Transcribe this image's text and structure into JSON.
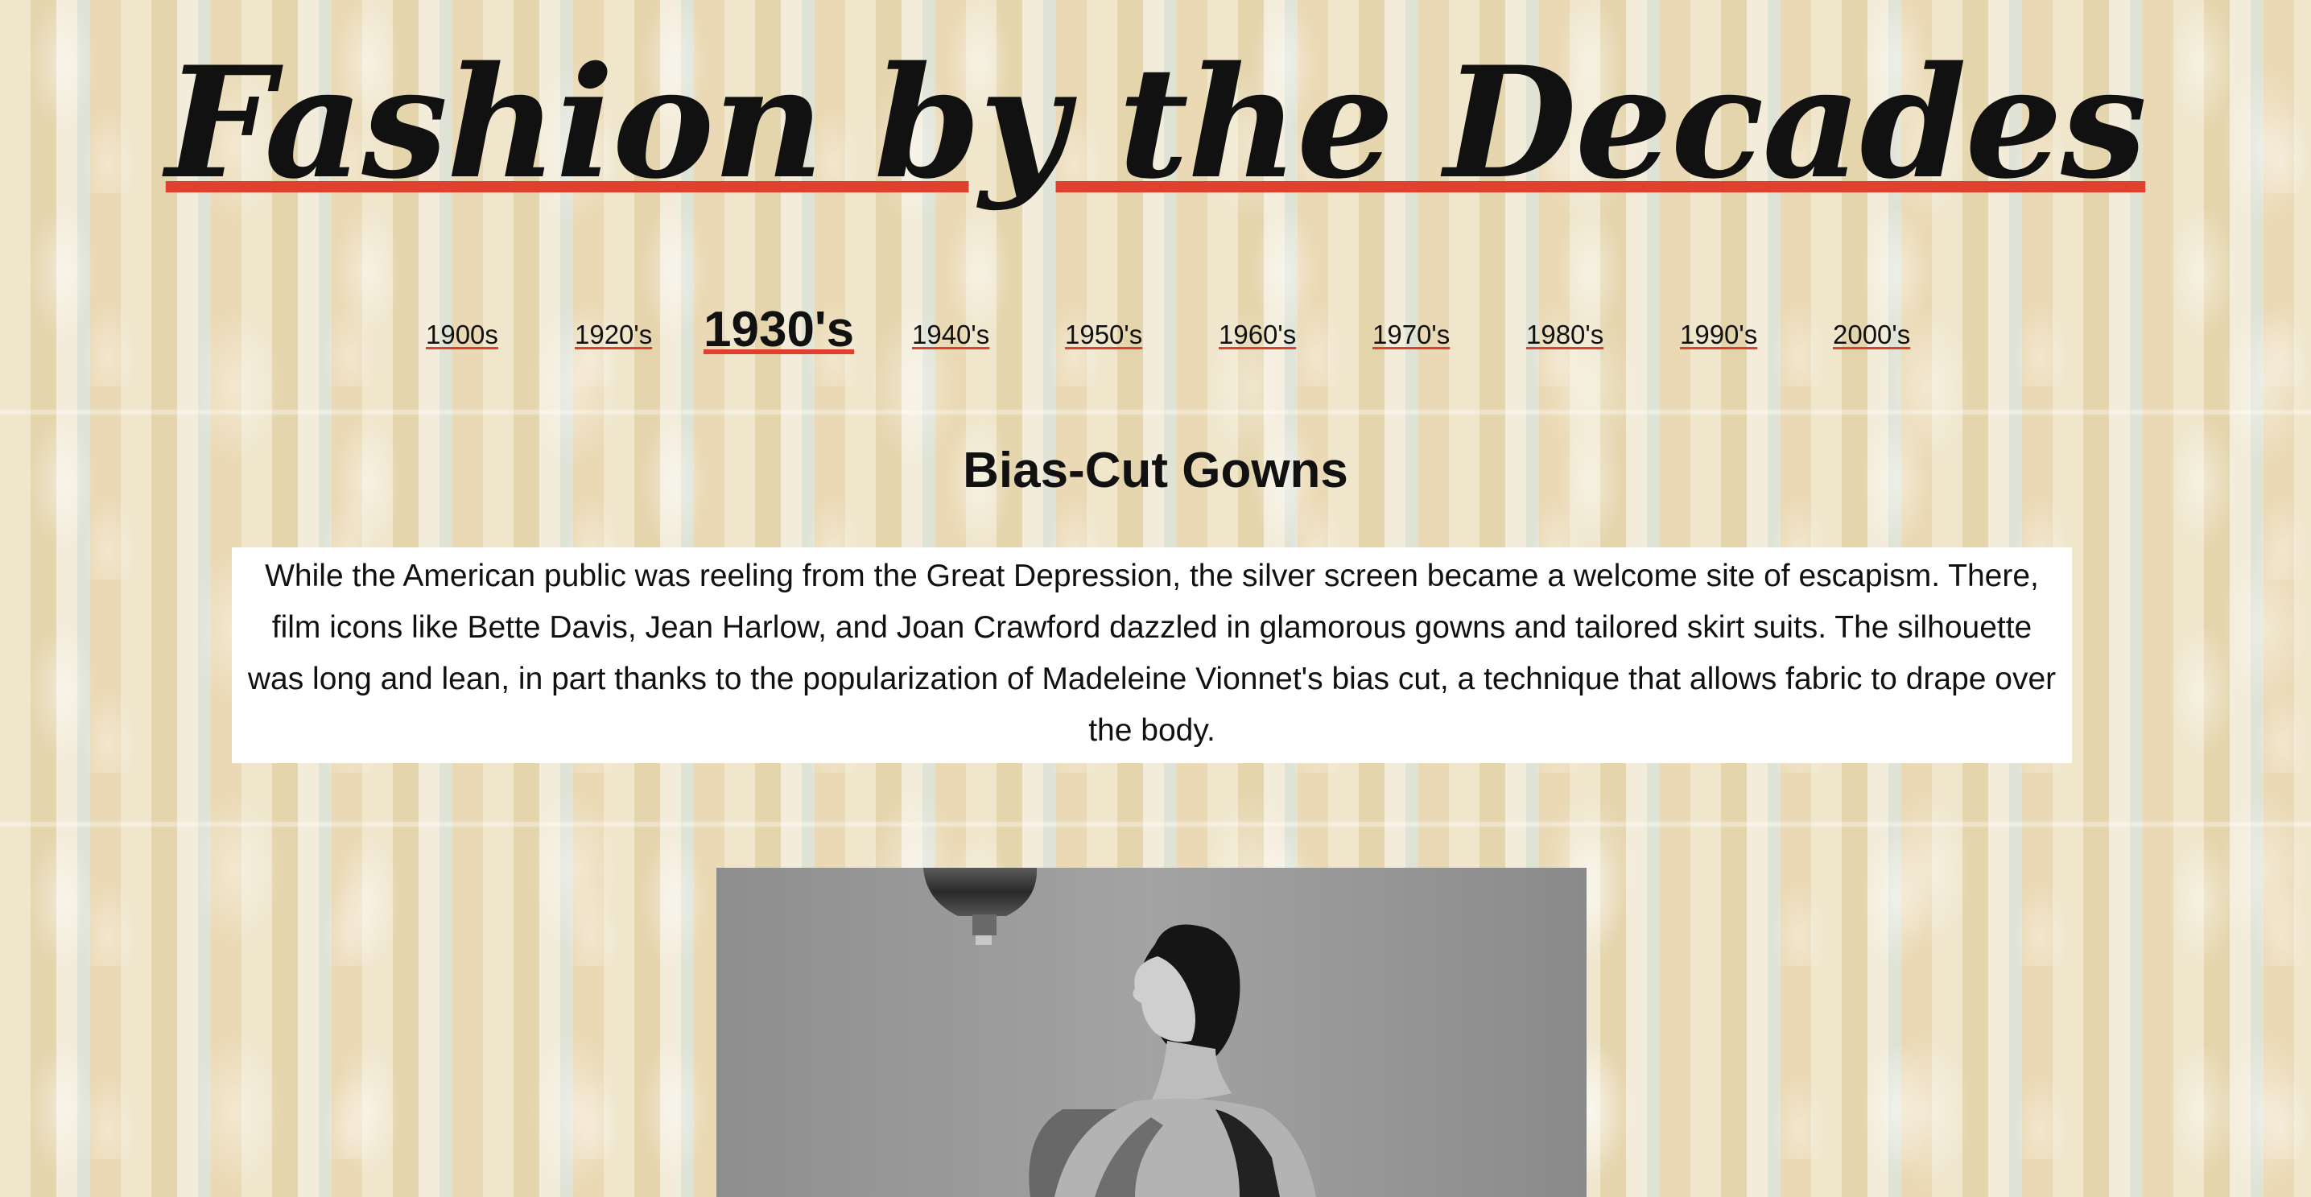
{
  "page": {
    "title": "Fashion by the Decades"
  },
  "nav": {
    "items": [
      {
        "label": "1900s"
      },
      {
        "label": "1920's"
      },
      {
        "label": "1930's",
        "active": true
      },
      {
        "label": "1940's"
      },
      {
        "label": "1950's"
      },
      {
        "label": "1960's"
      },
      {
        "label": "1970's"
      },
      {
        "label": "1980's"
      },
      {
        "label": "1990's"
      },
      {
        "label": "2000's"
      }
    ]
  },
  "section": {
    "heading": "Bias-Cut Gowns",
    "body": "While the American public was reeling from the Great Depression, the silver screen became a welcome site of escapism. There, film icons like Bette Davis, Jean Harlow, and Joan Crawford dazzled in glamorous gowns and tailored skirt suits. The silhouette was long and lean, in part thanks to the popularization of Madeleine Vionnet's bias cut, a technique that allows fabric to drape over the body."
  },
  "colors": {
    "accent_underline": "#e0412e",
    "text": "#111111",
    "paragraph_background": "#ffffff"
  }
}
